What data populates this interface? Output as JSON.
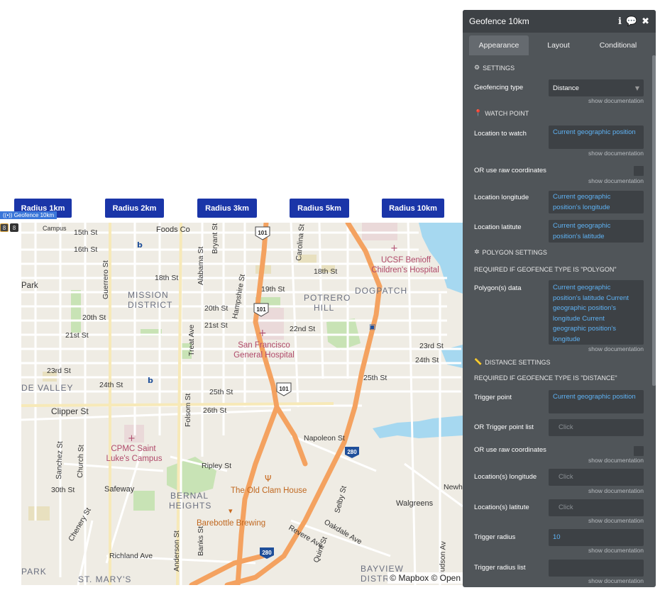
{
  "buttons": [
    {
      "label": "Radius 1km",
      "name": "radius-1km-button"
    },
    {
      "label": "Radius 2km",
      "name": "radius-2km-button"
    },
    {
      "label": "Radius 3km",
      "name": "radius-3km-button"
    },
    {
      "label": "Radius 5km",
      "name": "radius-5km-button"
    },
    {
      "label": "Radius 10km",
      "name": "radius-10km-button"
    }
  ],
  "element_tag": "Geofence 10km",
  "map": {
    "attribution": "© Mapbox © Open",
    "labels": {
      "foods_co": "Foods Co",
      "s15": "15th St",
      "s16": "16th St",
      "s18": "18th St",
      "s19": "19th St",
      "s18b": "18th St",
      "s20": "20th St",
      "s21": "21st St",
      "s20b": "20th St",
      "s21b": "21st St",
      "s22": "22nd St",
      "s23": "23rd St",
      "s24": "24th St",
      "s25": "25th St",
      "s26": "26th St",
      "s25b": "25th St",
      "s23b": "23rd St",
      "s24b": "24th St",
      "s30": "30th St",
      "guerrero": "Guerrero St",
      "bryant": "Bryant St",
      "alabama": "Alabama St",
      "hampshire": "Hampshire St",
      "carolina": "Carolina St",
      "treat": "Treat Ave",
      "folsom": "Folsom St",
      "sanchez": "Sanchez St",
      "church": "Church St",
      "chenery": "Chenery St",
      "banks": "Banks St",
      "anderson": "Anderson St",
      "quint": "Quint St",
      "selby": "Selby St",
      "hudson": "Hudson Av",
      "mission_1": "MISSION",
      "mission_2": "DISTRICT",
      "potrero_1": "POTRERO",
      "potrero_2": "HILL",
      "dogpatch": "DOGPATCH",
      "bernal_1": "BERNAL",
      "bernal_2": "HEIGHTS",
      "bayview": "BAYVIEW",
      "bayview_2": "DISTR",
      "stmarys": "ST. MARY'S",
      "park_top": "Park",
      "de_valley": "DE VALLEY",
      "park_bottom": "PARK",
      "clipper": "Clipper St",
      "napoleon": "Napoleon St",
      "ripley": "Ripley St",
      "richland": "Richland Ave",
      "revere": "Revere Ave",
      "oakdale": "Oakdale Ave",
      "newhall": "Newha",
      "ucsf_1": "UCSF Benioff",
      "ucsf_2": "Children's Hospital",
      "sfgh_1": "San Francisco",
      "sfgh_2": "General Hospital",
      "cpmc_1": "CPMC Saint",
      "cpmc_2": "Luke's Campus",
      "clam": "The Old Clam House",
      "barebottle": "Barebottle Brewing",
      "safeway": "Safeway",
      "walgreens": "Walgreens",
      "campus": "Campus",
      "hw101": "101",
      "hw280": "280"
    }
  },
  "panel": {
    "title": "Geofence 10km",
    "tabs": [
      "Appearance",
      "Layout",
      "Conditional"
    ],
    "sections": {
      "settings": "SETTINGS",
      "watch_point": "WATCH POINT",
      "polygon_settings": "POLYGON SETTINGS",
      "polygon_req": "REQUIRED IF GEOFENCE TYPE IS \"POLYGON\"",
      "distance_settings": "DISTANCE SETTINGS",
      "distance_req": "REQUIRED IF GEOFENCE TYPE IS \"DISTANCE\""
    },
    "doc_link": "show documentation",
    "fields": {
      "geofencing_type": {
        "label": "Geofencing type",
        "value": "Distance"
      },
      "location_to_watch": {
        "label": "Location to watch",
        "value": "Current geographic position"
      },
      "raw_coords": {
        "label": "OR use raw coordinates"
      },
      "loc_longitude": {
        "label": "Location longitude",
        "value": "Current geographic position's longitude"
      },
      "loc_latitude": {
        "label": "Location latitute",
        "value": "Current geographic position's latitude"
      },
      "polygons": {
        "label": "Polygon(s) data",
        "value": " Current geographic position's latitude  Current geographic position's longitude  Current geographic position's longitude"
      },
      "trigger_point": {
        "label": "Trigger point",
        "value": "Current geographic position"
      },
      "trigger_point_list": {
        "label": "OR Trigger point list",
        "value": "Click"
      },
      "raw_coords_2": {
        "label": "OR use raw coordinates"
      },
      "locs_longitude": {
        "label": "Location(s) longitude",
        "value": "Click"
      },
      "locs_latitude": {
        "label": "Location(s) latitute",
        "value": "Click"
      },
      "trigger_radius": {
        "label": "Trigger radius",
        "value": "10"
      },
      "trigger_radius_list": {
        "label": "Trigger radius list",
        "value": ""
      }
    }
  }
}
